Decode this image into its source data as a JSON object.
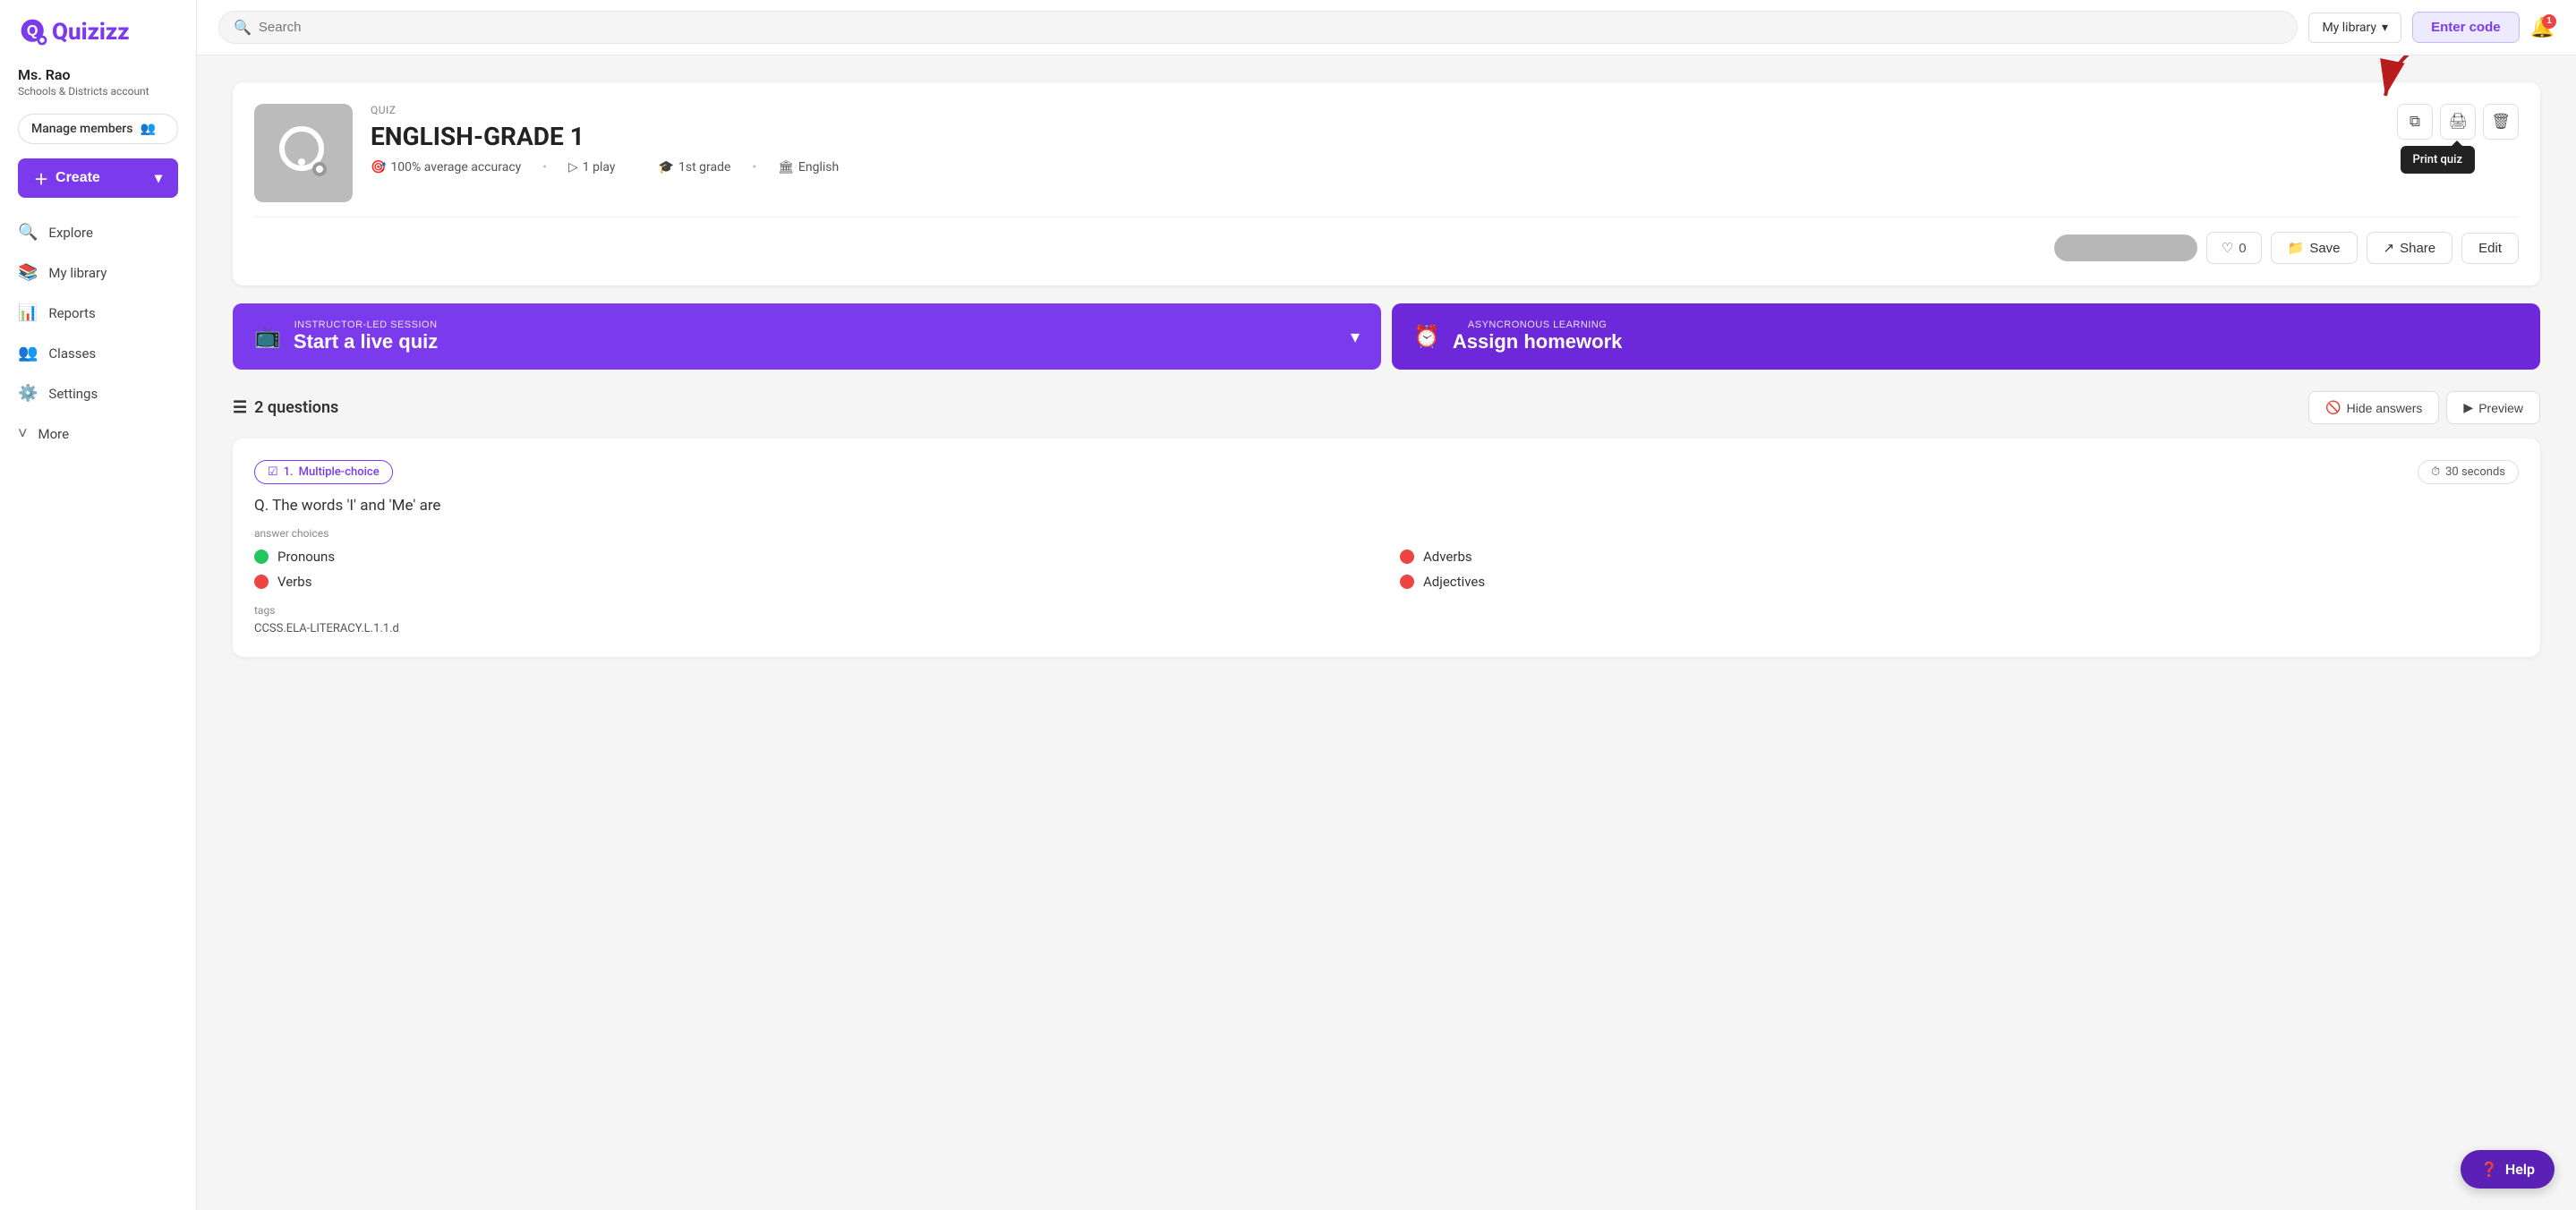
{
  "sidebar": {
    "logo": "Quizizz",
    "user": {
      "name": "Ms. Rao",
      "account_type": "Schools & Districts account"
    },
    "manage_members_label": "Manage members",
    "create_label": "Create",
    "nav_items": [
      {
        "id": "explore",
        "label": "Explore",
        "icon": "🔍"
      },
      {
        "id": "my-library",
        "label": "My library",
        "icon": "📚"
      },
      {
        "id": "reports",
        "label": "Reports",
        "icon": "📊"
      },
      {
        "id": "classes",
        "label": "Classes",
        "icon": "👥"
      },
      {
        "id": "settings",
        "label": "Settings",
        "icon": "⚙️"
      },
      {
        "id": "more",
        "label": "More",
        "icon": "˅"
      }
    ]
  },
  "header": {
    "search_placeholder": "Search",
    "library_label": "My library",
    "enter_code_label": "Enter code",
    "notification_count": "1"
  },
  "quiz": {
    "type_label": "QUIZ",
    "title": "ENGLISH-GRADE 1",
    "accuracy": "100% average accuracy",
    "plays": "1 play",
    "grade": "1st grade",
    "language": "English",
    "copy_icon": "📋",
    "print_icon": "🖨",
    "delete_icon": "🗑",
    "tooltip_text": "Print quiz",
    "like_count": "0",
    "save_label": "Save",
    "share_label": "Share",
    "edit_label": "Edit"
  },
  "sessions": {
    "live": {
      "label": "INSTRUCTOR-LED SESSION",
      "title": "Start a live quiz",
      "icon": "📺"
    },
    "homework": {
      "label": "ASYNCRONOUS LEARNING",
      "title": "Assign homework",
      "icon": "⏰"
    }
  },
  "questions": {
    "count_label": "2 questions",
    "hide_answers_label": "Hide answers",
    "preview_label": "Preview",
    "list": [
      {
        "number": "1",
        "type": "Multiple-choice",
        "time": "30 seconds",
        "question": "Q. The words 'I' and 'Me' are",
        "answer_choices_label": "answer choices",
        "answers": [
          {
            "label": "Pronouns",
            "correct": true
          },
          {
            "label": "Adverbs",
            "correct": false
          },
          {
            "label": "Verbs",
            "correct": false
          },
          {
            "label": "Adjectives",
            "correct": false
          }
        ],
        "tags_label": "tags",
        "tag_value": "CCSS.ELA-LITERACY.L.1.1.d"
      }
    ]
  },
  "help": {
    "label": "Help"
  }
}
